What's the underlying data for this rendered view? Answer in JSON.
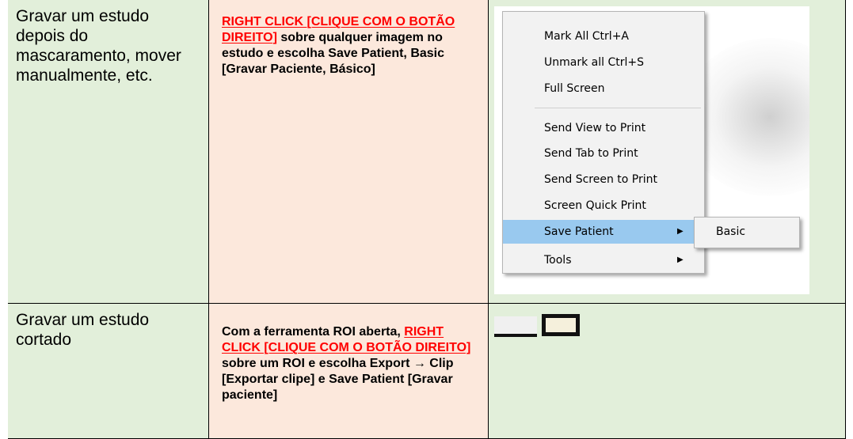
{
  "rows": [
    {
      "label": "Gravar um estudo depois do mascaramento, mover manualmente, etc.",
      "instr_red": "RIGHT CLICK [CLIQUE COM O BOTÃO DIREITO]",
      "instr_rest": " sobre qualquer imagem no estudo e escolha Save Patient, Basic [Gravar Paciente, Básico]"
    },
    {
      "label": "Gravar um estudo cortado",
      "instr_pre": "Com a ferramenta ROI aberta, ",
      "instr_red": "RIGHT CLICK [CLIQUE COM O BOTÃO DIREITO]",
      "instr_rest": " sobre um ROI e escolha Export → Clip [Exportar clipe] e Save Patient [Gravar paciente]"
    }
  ],
  "context_menu": {
    "items": [
      {
        "label": "Mark All  Ctrl+A"
      },
      {
        "label": "Unmark all  Ctrl+S"
      },
      {
        "label": "Full Screen"
      },
      {
        "label": "Send View to Print"
      },
      {
        "label": "Send Tab to Print"
      },
      {
        "label": "Send Screen to Print"
      },
      {
        "label": "Screen Quick Print"
      },
      {
        "label": "Save Patient",
        "highlighted": true,
        "submenu": true
      },
      {
        "label": "Tools",
        "submenu": true
      }
    ],
    "submenu_item": "Basic",
    "highlight_color": "#99c9ef"
  },
  "colors": {
    "green_cell": "#e2efda",
    "peach_cell": "#fce8dc",
    "red_text": "#ff0000"
  }
}
